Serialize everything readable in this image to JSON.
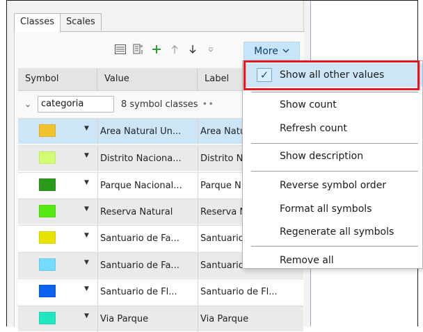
{
  "tabs": [
    {
      "label": "Classes",
      "active": true
    },
    {
      "label": "Scales",
      "active": false
    }
  ],
  "toolbar": {
    "icons": [
      "list-view-icon",
      "add-from-field-icon",
      "add-class-icon",
      "move-up-icon",
      "move-down-icon",
      "collapse-icon"
    ],
    "more_label": "More"
  },
  "table": {
    "columns": [
      "Symbol",
      "Value",
      "Label"
    ],
    "group": {
      "field": "categoria",
      "count_text": "8 symbol classes",
      "dots": "••"
    },
    "rows": [
      {
        "color": "#f2c12e",
        "value": "Area Natural Un...",
        "label": "Area Natu"
      },
      {
        "color": "#d2fd73",
        "value": "Distrito Naciona...",
        "label": "Distrito N"
      },
      {
        "color": "#2a9b18",
        "value": "Parque Nacional...",
        "label": "Parque N"
      },
      {
        "color": "#54e712",
        "value": "Reserva Natural",
        "label": "Reserva N"
      },
      {
        "color": "#e8e300",
        "value": "Santuario de Fa...",
        "label": "Santuario"
      },
      {
        "color": "#73dbfd",
        "value": "Santuario de Fa...",
        "label": "Santuario"
      },
      {
        "color": "#0c62f0",
        "value": "Santuario de Fl...",
        "label": "Santuario de Fl..."
      },
      {
        "color": "#1fe8c0",
        "value": "Via Parque",
        "label": "Via Parque"
      }
    ]
  },
  "menu": {
    "items": [
      {
        "label": "Show all other values",
        "checked": true
      },
      {
        "label": "Show count"
      },
      {
        "label": "Refresh count"
      },
      {
        "label": "Show description"
      },
      {
        "label": "Reverse symbol order"
      },
      {
        "label": "Format all symbols"
      },
      {
        "label": "Regenerate all symbols"
      },
      {
        "label": "Remove all"
      }
    ]
  }
}
